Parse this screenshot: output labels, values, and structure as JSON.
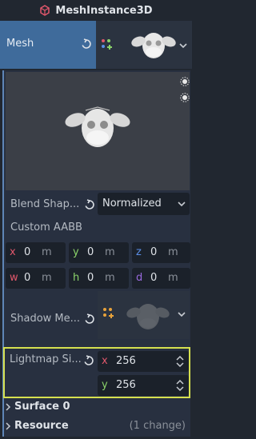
{
  "header": {
    "title": "MeshInstance3D",
    "icon": "mesh-instance-icon"
  },
  "mesh": {
    "label": "Mesh",
    "revert_icon": "revert-icon",
    "resource_icon": "mesh-resource-icon",
    "thumbnail": "suzanne-monkey-head"
  },
  "preview": {
    "light_icons": [
      "light-toggle-icon",
      "light-toggle-icon"
    ]
  },
  "blend_shape": {
    "label": "Blend Shap...",
    "value": "Normalized"
  },
  "custom_aabb": {
    "label": "Custom AABB",
    "fields": [
      {
        "axis": "x",
        "value": "0",
        "unit": "m",
        "color": "#e0576b"
      },
      {
        "axis": "y",
        "value": "0",
        "unit": "m",
        "color": "#8bd36a"
      },
      {
        "axis": "z",
        "value": "0",
        "unit": "m",
        "color": "#5b8fe8"
      },
      {
        "axis": "w",
        "value": "0",
        "unit": "m",
        "color": "#e0576b"
      },
      {
        "axis": "h",
        "value": "0",
        "unit": "m",
        "color": "#8bd36a"
      },
      {
        "axis": "d",
        "value": "0",
        "unit": "m",
        "color": "#9a6ae0"
      }
    ]
  },
  "shadow_mesh": {
    "label": "Shadow Me...",
    "resource_icon": "mesh-resource-icon"
  },
  "lightmap": {
    "label": "Lightmap Si...",
    "x": {
      "axis": "x",
      "value": "256",
      "color": "#e0576b"
    },
    "y": {
      "axis": "y",
      "value": "256",
      "color": "#8bd36a"
    },
    "highlight_color": "#d6e04f"
  },
  "sections": {
    "surface": "Surface 0",
    "resource": "Resource",
    "resource_change": "(1 change)"
  }
}
